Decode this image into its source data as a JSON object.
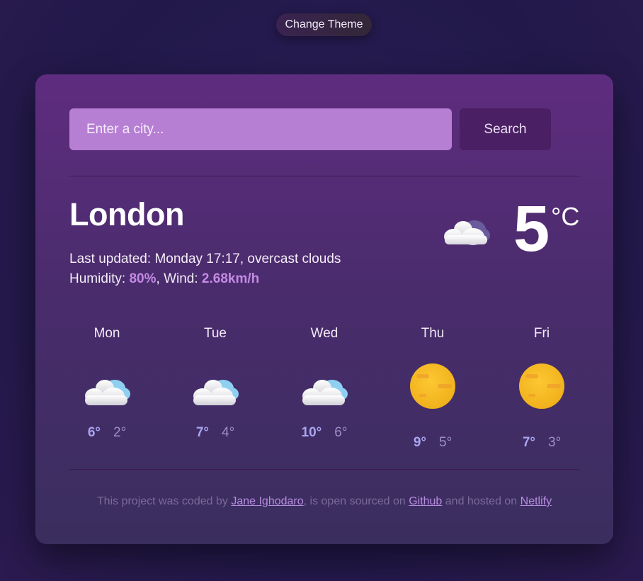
{
  "theme_button": {
    "label": "Change Theme"
  },
  "search": {
    "placeholder": "Enter a city...",
    "button_label": "Search"
  },
  "current": {
    "city": "London",
    "updated_prefix": "Last updated:",
    "updated_time": "Monday 17:17",
    "description": "overcast clouds",
    "humidity_label": "Humidity:",
    "humidity": "80%",
    "wind_label": "Wind:",
    "wind": "2.68km/h",
    "temperature": "5",
    "unit": "°C",
    "icon": "cloud-icon"
  },
  "forecast": [
    {
      "day": "Mon",
      "max": "6°",
      "min": "2°",
      "icon": "cloud-icon"
    },
    {
      "day": "Tue",
      "max": "7°",
      "min": "4°",
      "icon": "cloud-icon"
    },
    {
      "day": "Wed",
      "max": "10°",
      "min": "6°",
      "icon": "cloud-icon"
    },
    {
      "day": "Thu",
      "max": "9°",
      "min": "5°",
      "icon": "sun-icon"
    },
    {
      "day": "Fri",
      "max": "7°",
      "min": "3°",
      "icon": "sun-icon"
    }
  ],
  "footer": {
    "text1": "This project was coded by",
    "author": "Jane Ighodaro",
    "text2": ", is open sourced on",
    "github": "Github",
    "text3": "and hosted on",
    "netlify": "Netlify"
  },
  "colors": {
    "accent": "#c48ae3",
    "input_bg": "#b67fd3",
    "button_bg": "#4a1f64",
    "max_temp": "#a9a5f0"
  }
}
